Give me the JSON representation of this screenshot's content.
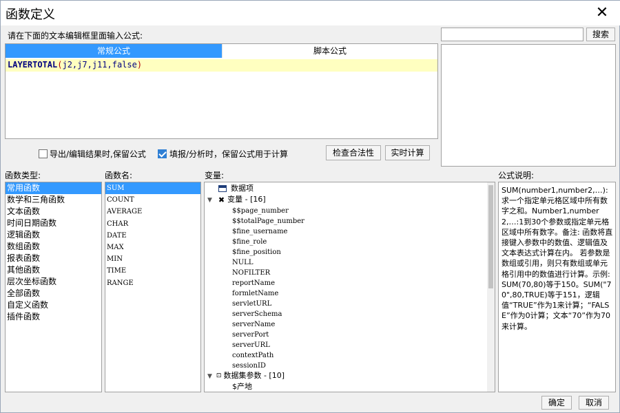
{
  "window": {
    "title": "函数定义"
  },
  "editor": {
    "prompt": "请在下面的文本编辑框里面输入公式:",
    "tabs": [
      {
        "label": "常规公式"
      },
      {
        "label": "脚本公式"
      }
    ],
    "formula": {
      "fn": "LAYERTOTAL",
      "open": "(",
      "args": "j2,j7,j11,false",
      "close": ")"
    }
  },
  "search": {
    "value": "",
    "button": "搜索"
  },
  "options": {
    "export_keep": {
      "label": "导出/编辑结果时,保留公式",
      "checked": false
    },
    "fill_keep": {
      "label": "填报/分析时，保留公式用于计算",
      "checked": true
    },
    "check_button": "检查合法性",
    "realtime_button": "实时计算"
  },
  "func_types": {
    "title": "函数类型:",
    "items": [
      "常用函数",
      "数学和三角函数",
      "文本函数",
      "时间日期函数",
      "逻辑函数",
      "数组函数",
      "报表函数",
      "其他函数",
      "层次坐标函数",
      "全部函数",
      "自定义函数",
      "插件函数"
    ],
    "selected": 0
  },
  "func_names": {
    "title": "函数名:",
    "items": [
      "SUM",
      "COUNT",
      "AVERAGE",
      "CHAR",
      "DATE",
      "MAX",
      "MIN",
      "TIME",
      "RANGE"
    ],
    "selected": 0
  },
  "variables": {
    "title": "变量:",
    "root_data": "数据项",
    "var_group": "变量 - [16]",
    "vars": [
      "$$page_number",
      "$$totalPage_number",
      "$fine_username",
      "$fine_role",
      "$fine_position",
      "NULL",
      "NOFILTER",
      "reportName",
      "formletName",
      "servletURL",
      "serverSchema",
      "serverName",
      "serverPort",
      "serverURL",
      "contextPath",
      "sessionID"
    ],
    "dataset_group": "数据集参数 - [10]",
    "dataset_first": "$产地"
  },
  "description": {
    "title": "公式说明:",
    "text": "SUM(number1,number2,…): 求一个指定单元格区域中所有数字之和。Number1,number2,…:1到30个参数或指定单元格区域中所有数字。备注:   函数将直接键入参数中的数值、逻辑值及文本表达式计算在内。    若参数是数组或引用，则只有数组或单元格引用中的数值进行计算。示例:SUM(70,80)等于150。SUM(\"70\",80,TRUE)等于151，逻辑值“TRUE”作为1来计算；“FALSE”作为0计算；文本“70”作为70来计算。"
  },
  "footer": {
    "ok": "确定",
    "cancel": "取消"
  },
  "colors": {
    "accent": "#3399ff",
    "highlight": "#ffffc0"
  }
}
